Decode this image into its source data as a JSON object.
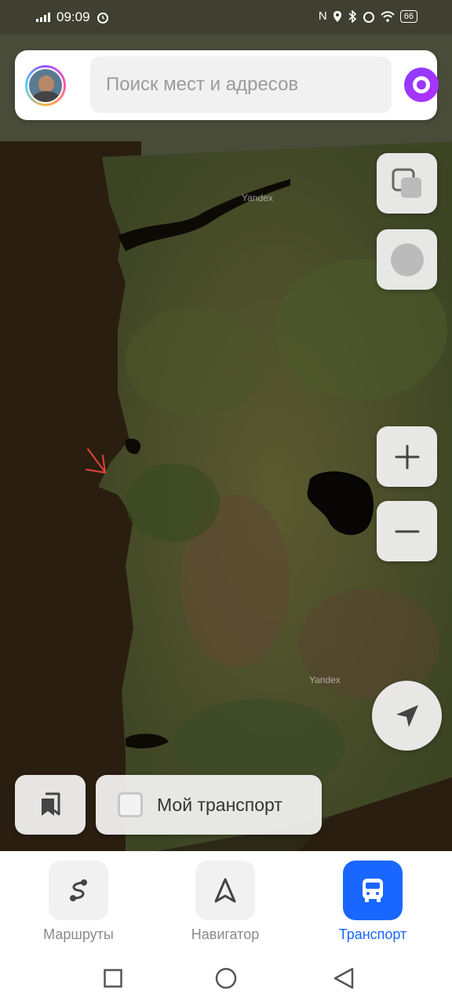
{
  "status_bar": {
    "time": "09:09",
    "battery": "66"
  },
  "search": {
    "placeholder": "Поиск мест и адресов"
  },
  "map": {
    "watermark_1": "Yandex",
    "watermark_2": "Yandex",
    "layer_mode": "satellite"
  },
  "my_transport": {
    "label": "Мой транспорт",
    "checked": false
  },
  "tabs": [
    {
      "label": "Маршруты",
      "active": false
    },
    {
      "label": "Навигатор",
      "active": false
    },
    {
      "label": "Транспорт",
      "active": true
    }
  ],
  "colors": {
    "accent": "#1967ff",
    "alice": "#9a38ff",
    "annotation_arrow": "#e0443a"
  }
}
